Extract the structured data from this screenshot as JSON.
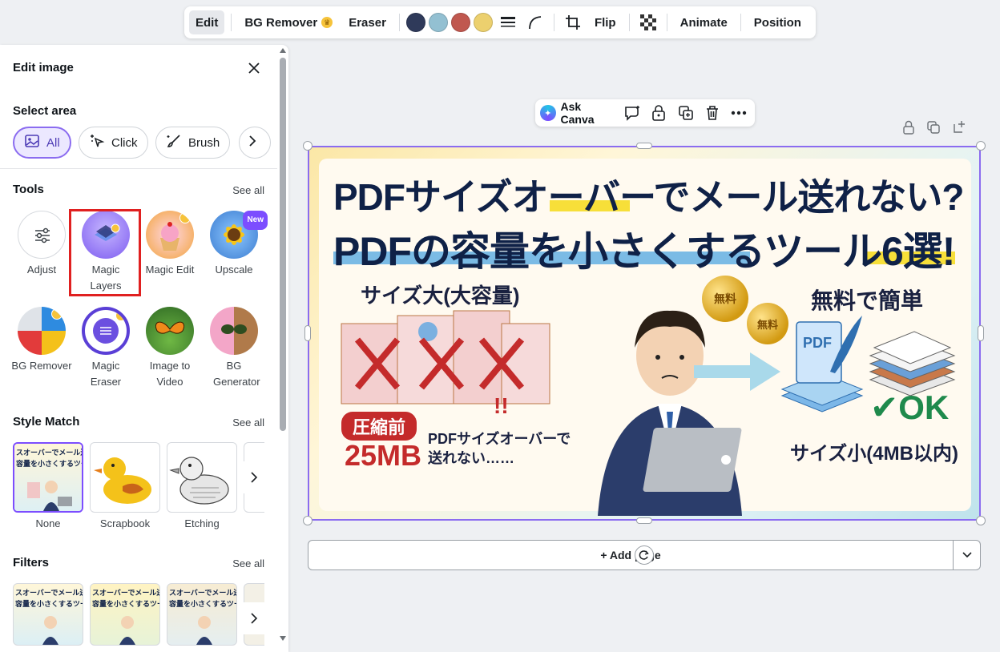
{
  "toolbar": {
    "edit": "Edit",
    "bg_remover": "BG Remover",
    "eraser": "Eraser",
    "swatches": [
      "#2f3a5a",
      "#93c0d2",
      "#c0584f",
      "#ecd06e"
    ],
    "flip": "Flip",
    "animate": "Animate",
    "position": "Position"
  },
  "panel": {
    "title": "Edit image",
    "select_area": {
      "title": "Select area",
      "options": [
        "All",
        "Click",
        "Brush"
      ]
    },
    "tools": {
      "title": "Tools",
      "see_all": "See all",
      "items": [
        {
          "label": "Adjust"
        },
        {
          "label": "Magic Layers"
        },
        {
          "label": "Magic Edit"
        },
        {
          "label": "Upscale",
          "badge": "New"
        },
        {
          "label": "BG Remover"
        },
        {
          "label": "Magic Eraser"
        },
        {
          "label": "Image to Video"
        },
        {
          "label": "BG Generator"
        }
      ]
    },
    "style_match": {
      "title": "Style Match",
      "see_all": "See all",
      "items": [
        "None",
        "Scrapbook",
        "Etching"
      ]
    },
    "filters": {
      "title": "Filters",
      "see_all": "See all"
    }
  },
  "canvas": {
    "ask_canva": "Ask Canva",
    "add_page": "+ Add page",
    "design": {
      "headline1": "PDFサイズオーバーでメール送れない?",
      "headline2": "PDFの容量を小さくするツール6選!",
      "sub_left": "サイズ大(大容量)",
      "sub_right": "無料で簡単",
      "medal": "無料",
      "pdf_label": "PDF",
      "badge": "圧縮前",
      "size_big": "25MB",
      "caption_line1": "PDFサイズオーバーで",
      "caption_line2": "送れない……",
      "ok": "OK",
      "size_small": "サイズ小(4MB以内)"
    },
    "thumb_text_line1": "スオーバーでメール送",
    "thumb_text_line2": "容量を小さくするツー"
  }
}
